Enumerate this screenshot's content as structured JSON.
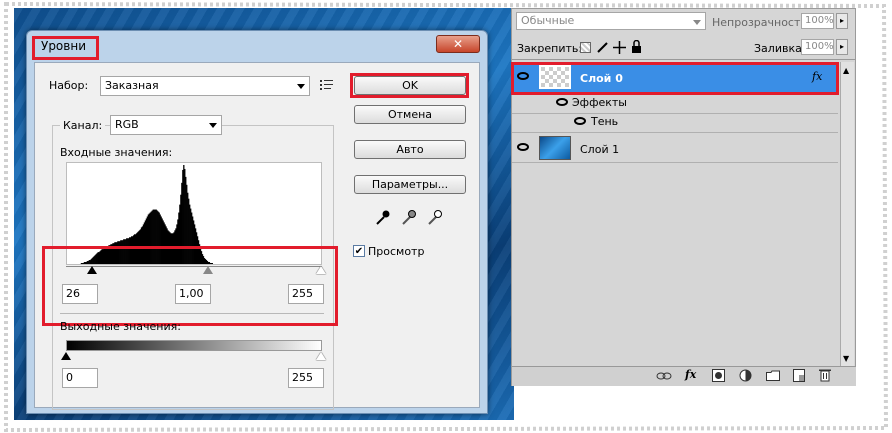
{
  "dialog": {
    "title": "Уровни",
    "close_symbol": "✕",
    "preset_label": "Набор:",
    "preset_value": "Заказная",
    "channel_label": "Канал:",
    "channel_value": "RGB",
    "input_levels_label": "Входные значения:",
    "output_levels_label": "Выходные значения:",
    "input_black": "26",
    "input_gamma": "1,00",
    "input_white": "255",
    "output_black": "0",
    "output_white": "255",
    "buttons": {
      "ok": "OK",
      "cancel": "Отмена",
      "auto": "Авто",
      "options": "Параметры..."
    },
    "preview_label": "Просмотр",
    "preview_checked": true,
    "histogram_profile": [
      0,
      0,
      0,
      0,
      0,
      0,
      0,
      0,
      0,
      0,
      0,
      0,
      0,
      0,
      1,
      1,
      1,
      2,
      2,
      2,
      3,
      3,
      4,
      4,
      5,
      6,
      7,
      8,
      9,
      10,
      11,
      12,
      12,
      13,
      14,
      15,
      15,
      16,
      17,
      17,
      18,
      18,
      19,
      19,
      20,
      20,
      21,
      21,
      22,
      22,
      22,
      23,
      23,
      23,
      24,
      24,
      24,
      25,
      25,
      25,
      26,
      26,
      26,
      27,
      27,
      28,
      28,
      29,
      30,
      30,
      31,
      32,
      33,
      34,
      35,
      37,
      38,
      40,
      42,
      44,
      46,
      48,
      50,
      51,
      52,
      53,
      54,
      55,
      55,
      55,
      55,
      54,
      53,
      52,
      50,
      48,
      46,
      44,
      42,
      40,
      38,
      36,
      34,
      33,
      32,
      31,
      31,
      31,
      32,
      34,
      36,
      40,
      45,
      52,
      60,
      70,
      82,
      95,
      100,
      96,
      88,
      80,
      72,
      66,
      60,
      56,
      52,
      48,
      44,
      40,
      36,
      32,
      28,
      24,
      20,
      16,
      13,
      10,
      8,
      6,
      5,
      4,
      3,
      2,
      2,
      1,
      1,
      1,
      0,
      0,
      0,
      0,
      0,
      0,
      0,
      0,
      0,
      0,
      0,
      0,
      0,
      0,
      0,
      0,
      0,
      0,
      0,
      0,
      0,
      0,
      0,
      0,
      0,
      0,
      0,
      0,
      0,
      0,
      0,
      0,
      0,
      0,
      0,
      0,
      0,
      0,
      0,
      0,
      0,
      0,
      0,
      0,
      0,
      0,
      0,
      0,
      0,
      0,
      0,
      0,
      0,
      0,
      0,
      0,
      0,
      0,
      0,
      0,
      0,
      0,
      0,
      0,
      0,
      0,
      0,
      0,
      0,
      0,
      0,
      0,
      0,
      0,
      0,
      0,
      0,
      0,
      0,
      0,
      0,
      0,
      0,
      0,
      0,
      0,
      0,
      0,
      0,
      0,
      0,
      0,
      0,
      0,
      0,
      0,
      0,
      0,
      0,
      0,
      0,
      0,
      0,
      0,
      0,
      0,
      0,
      0,
      0,
      0
    ]
  },
  "layers_panel": {
    "blend_mode": "Обычные",
    "opacity_label": "Непрозрачность:",
    "opacity_value": "100%",
    "lock_label": "Закрепить:",
    "fill_label": "Заливка:",
    "fill_value": "100%",
    "layers": [
      {
        "name": "Слой 0",
        "selected": true,
        "fx": "fx"
      },
      {
        "name": "Эффекты",
        "sub": true
      },
      {
        "name": "Тень",
        "sub": true
      },
      {
        "name": "Слой 1",
        "selected": false
      }
    ],
    "footer_icons": [
      "link-icon",
      "fx-icon",
      "mask-icon",
      "adjustment-icon",
      "group-icon",
      "new-layer-icon",
      "trash-icon"
    ],
    "footer_fx": "fx"
  },
  "colors": {
    "highlight": "#e21c2c",
    "selection": "#3a8ee6"
  }
}
